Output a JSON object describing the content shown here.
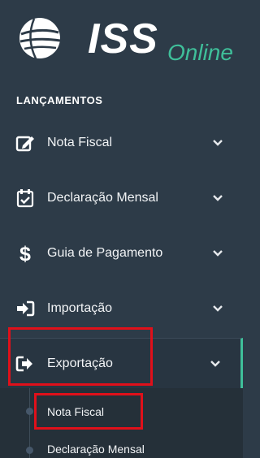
{
  "logo": {
    "brand": "ISS",
    "suffix": "Online",
    "accent_color": "#3fbf9a"
  },
  "sidebar": {
    "section_title": "LANÇAMENTOS",
    "items": [
      {
        "label": "Nota Fiscal",
        "icon": "edit-icon"
      },
      {
        "label": "Declaração Mensal",
        "icon": "calendar-check-icon"
      },
      {
        "label": "Guia de Pagamento",
        "icon": "dollar-icon"
      },
      {
        "label": "Importação",
        "icon": "sign-in-icon"
      },
      {
        "label": "Exportação",
        "icon": "sign-out-icon",
        "active": true
      }
    ],
    "submenu": [
      {
        "label": "Nota Fiscal",
        "highlighted": true
      },
      {
        "label": "Declaração Mensal"
      }
    ]
  },
  "colors": {
    "background": "#2d3b48",
    "highlight": "#e0101a",
    "accent": "#3fbf9a"
  }
}
